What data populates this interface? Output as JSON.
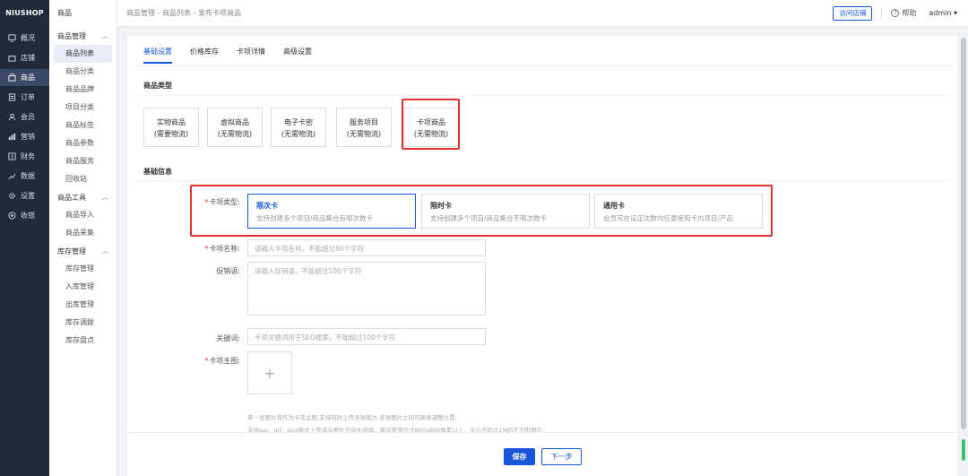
{
  "nav": {
    "logo": "NIUSHOP",
    "items": [
      {
        "label": "概况",
        "icon": "monitor-icon"
      },
      {
        "label": "店铺",
        "icon": "store-icon"
      },
      {
        "label": "商品",
        "icon": "bag-icon"
      },
      {
        "label": "订单",
        "icon": "order-icon"
      },
      {
        "label": "会员",
        "icon": "user-icon"
      },
      {
        "label": "营销",
        "icon": "chart-icon"
      },
      {
        "label": "财务",
        "icon": "finance-icon"
      },
      {
        "label": "数据",
        "icon": "data-icon"
      },
      {
        "label": "设置",
        "icon": "gear-icon"
      },
      {
        "label": "收银",
        "icon": "cashier-icon"
      }
    ],
    "active_index": 2
  },
  "subnav": {
    "title": "商品",
    "groups": [
      {
        "label": "商品管理",
        "items": [
          "商品列表",
          "商品分类",
          "商品品牌",
          "项目分类",
          "商品标签",
          "商品参数",
          "商品服务",
          "回收站"
        ]
      },
      {
        "label": "商品工具",
        "items": [
          "商品导入",
          "商品采集"
        ]
      },
      {
        "label": "库存管理",
        "items": [
          "库存管理",
          "入库管理",
          "出库管理",
          "库存调拨",
          "库存盘点"
        ]
      }
    ]
  },
  "header": {
    "breadcrumb": "商品管理  -  商品列表  -  发布卡项商品",
    "visit_store": "访问店铺",
    "help": "帮助",
    "user": "admin"
  },
  "tabs": [
    "基础设置",
    "价格库存",
    "卡项详情",
    "高级设置"
  ],
  "product_type": {
    "title": "商品类型",
    "options": [
      {
        "name": "实物商品",
        "sub": "(需要物流)"
      },
      {
        "name": "虚拟商品",
        "sub": "(无需物流)"
      },
      {
        "name": "电子卡密",
        "sub": "(无需物流)"
      },
      {
        "name": "服务项目",
        "sub": "(无需物流)"
      },
      {
        "name": "卡项商品",
        "sub": "(无需物流)"
      }
    ]
  },
  "basic_info": {
    "title": "基础信息",
    "card_type_label": "卡项类型:",
    "card_types": [
      {
        "name": "限次卡",
        "desc": "支持创建多个项目/商品集合有限次数卡"
      },
      {
        "name": "限时卡",
        "desc": "支持创建多个项目/商品集合不限次数卡"
      },
      {
        "name": "通用卡",
        "desc": "会员可在设定次数内任意使用卡内项目/产品"
      }
    ],
    "name_label": "卡项名称:",
    "name_placeholder": "请输入卡项名称，不能超过60个字符",
    "promo_label": "促销语:",
    "promo_placeholder": "请输入促销语，不能超过100个字符",
    "keyword_label": "关键词:",
    "keyword_placeholder": "卡项关键词用于SEO搜索，不能超过100个字符",
    "image_label": "卡项主图:",
    "upload_plus": "+",
    "hint1": "第一张图片将作为卡项主图,支持同时上传多张图片,多张图片之间可随意调整位置;",
    "hint2": "支持jpg、gif、png格式上传或从图片空间中选择，建议使用尺寸800x800像素以上、大小不超过1M的正方形图片;"
  },
  "footer": {
    "save": "保存",
    "next": "下一步"
  },
  "colors": {
    "primary": "#1a56db",
    "highlight": "#e0302c",
    "sidebar": "#1f2a3d"
  }
}
